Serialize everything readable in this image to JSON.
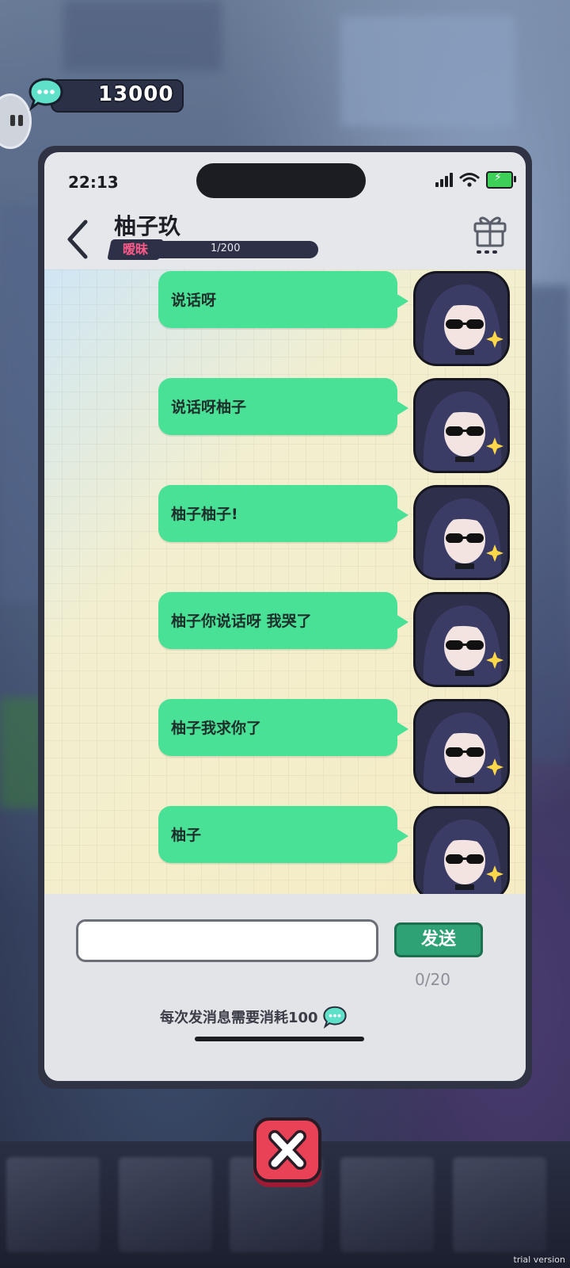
{
  "currency": {
    "amount": "13000",
    "icon": "chat-bubble-icon"
  },
  "phone": {
    "status_time": "22:13",
    "contact_name": "柚子玖",
    "relationship": {
      "tag": "暧昧",
      "progress": "1/200",
      "value": 1,
      "max": 200
    }
  },
  "messages": [
    {
      "text": "说话呀"
    },
    {
      "text": "说话呀柚子"
    },
    {
      "text": "柚子柚子!"
    },
    {
      "text": "柚子你说话呀 我哭了"
    },
    {
      "text": "柚子我求你了"
    },
    {
      "text": "柚子"
    }
  ],
  "input": {
    "value": "",
    "placeholder": "",
    "send_label": "发送",
    "counter": "0/20"
  },
  "cost_note": "每次发消息需要消耗100",
  "watermark": "trial version",
  "colors": {
    "bubble": "#48e196",
    "send": "#2fa275",
    "close": "#e94156",
    "relationship_tag": "#ff5a8a"
  }
}
